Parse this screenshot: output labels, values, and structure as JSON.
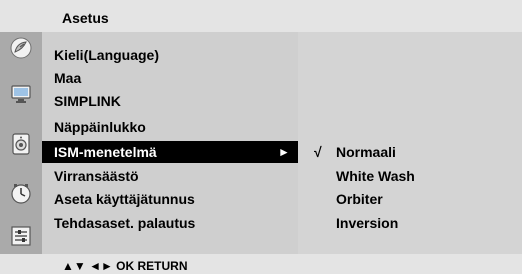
{
  "title": "Asetus",
  "sidebar": {
    "icons": [
      "satellite-dish-icon",
      "monitor-icon",
      "speaker-icon",
      "clock-icon",
      "settings-panel-icon"
    ]
  },
  "menu": {
    "items": [
      {
        "label": "Kieli(Language)"
      },
      {
        "label": "Maa"
      },
      {
        "label": "SIMPLINK"
      },
      {
        "label": "Näppäinlukko"
      },
      {
        "label": "ISM-menetelmä",
        "arrow": "►"
      },
      {
        "label": "Virransäästö"
      },
      {
        "label": "Aseta käyttäjätunnus"
      },
      {
        "label": "Tehdasaset. palautus"
      }
    ]
  },
  "submenu": {
    "check": "√",
    "options": [
      {
        "label": "Normaali"
      },
      {
        "label": "White Wash"
      },
      {
        "label": "Orbiter"
      },
      {
        "label": "Inversion"
      }
    ]
  },
  "footer": {
    "hint": "▲▼  ◄►  OK  RETURN"
  },
  "colors": {
    "title_bar": "#e4e4e4",
    "sidebar": "#aaaaaa",
    "menu_bg": "#cfcfcf",
    "submenu_bg": "#d4d4d4",
    "selected_bg": "#000000",
    "selected_text": "#ffffff"
  }
}
